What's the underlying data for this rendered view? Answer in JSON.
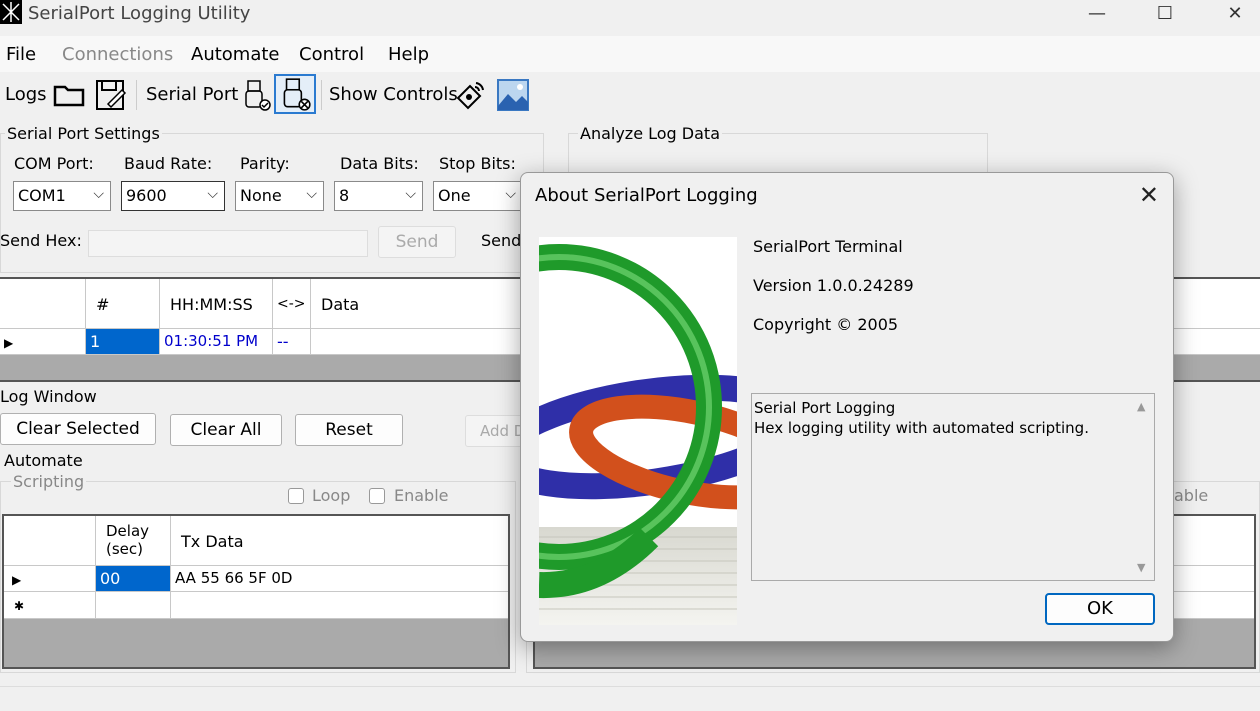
{
  "window": {
    "title": "SerialPort Logging Utility",
    "minimize": "—",
    "maximize": "☐",
    "close": "✕"
  },
  "menu": [
    "File",
    "Connections",
    "Automate",
    "Control",
    "Help"
  ],
  "toolbar": {
    "logs_label": "Logs",
    "serial_port_label": "Serial Port",
    "show_controls_label": "Show Controls"
  },
  "serial_settings": {
    "title": "Serial Port Settings",
    "com_port": {
      "label": "COM Port:",
      "value": "COM1"
    },
    "baud_rate": {
      "label": "Baud Rate:",
      "value": "9600"
    },
    "parity": {
      "label": "Parity:",
      "value": "None"
    },
    "data_bits": {
      "label": "Data Bits:",
      "value": "8"
    },
    "stop_bits": {
      "label": "Stop Bits:",
      "value": "One"
    },
    "send_hex_label": "Send Hex:",
    "send_button": "Send",
    "send2_label": "Send"
  },
  "analyze": {
    "title": "Analyze Log Data"
  },
  "log_grid": {
    "headers": [
      "#",
      "HH:MM:SS",
      "<->",
      "Data"
    ],
    "rows": [
      {
        "num": "1",
        "time": "01:30:51 PM",
        "dir": "--",
        "data": ""
      }
    ]
  },
  "log_window": {
    "title": "Log Window",
    "clear_selected": "Clear Selected",
    "clear_all": "Clear All",
    "reset": "Reset",
    "add": "Add D"
  },
  "automate": {
    "title": "Automate",
    "scripting": "Scripting",
    "loop": "Loop",
    "enable": "Enable",
    "enable2_partial": "able",
    "headers": [
      "Delay (sec)",
      "Tx Data"
    ],
    "rows": [
      {
        "delay": "00",
        "tx": "AA 55 66 5F 0D"
      }
    ]
  },
  "about_dialog": {
    "title": "About SerialPort Logging",
    "product": "SerialPort Terminal",
    "version": "Version 1.0.0.24289",
    "copyright": "Copyright © 2005",
    "description_line1": "Serial Port Logging",
    "description_line2": "Hex logging utility with automated scripting.",
    "ok": "OK"
  },
  "colors": {
    "selection": "#0066cc",
    "ok_border": "#0067c0",
    "time_text": "#0000cc"
  }
}
